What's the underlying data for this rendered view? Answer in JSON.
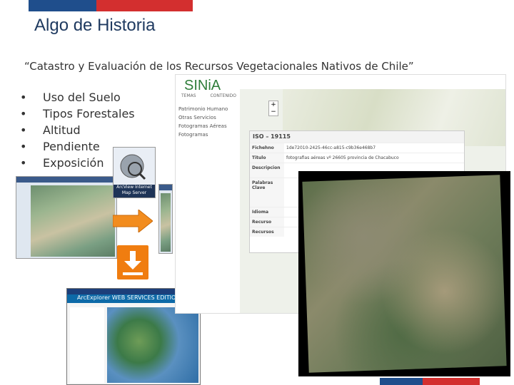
{
  "slide": {
    "title": "Algo de Historia",
    "subtitle": "“Catastro y Evaluación de los Recursos Vegetacionales Nativos de Chile”",
    "bullets": [
      "Uso del Suelo",
      "Tipos Forestales",
      "Altitud",
      "Pendiente",
      "Exposición"
    ]
  },
  "colors": {
    "flag_blue": "#1f4e8c",
    "flag_red": "#d32f2f",
    "title_color": "#1f3a60",
    "orange_arrow": "#f07d10"
  },
  "collage": {
    "ims_label": "ArcView Internet Map Server",
    "arcexplorer_label": "ArcExplorer WEB SERVICES EDITION",
    "download_icon": "download-arrow-icon"
  },
  "sinia": {
    "logo": "SINiA",
    "tabs": [
      "TEMAS",
      "CONTENIDO"
    ],
    "layers": [
      "Patrimonio Humano",
      "Otras Servicios",
      "Fotogramas Aéreas",
      "Fotogramas"
    ],
    "card": {
      "header": "ISO – 19115",
      "rows": [
        {
          "key": "Fichehno",
          "value": "1de72010-2425-46cc-a815-c9b36e468b7"
        },
        {
          "key": "Titulo",
          "value": "fotografias aéreas vº 26605 provincia de Chacabuco"
        },
        {
          "key": "Descripcion",
          "value": ""
        },
        {
          "key": "Palabras Clave",
          "value": ""
        },
        {
          "key": "Idioma",
          "value": ""
        },
        {
          "key": "Recurso",
          "value": ""
        },
        {
          "key": "Recursos",
          "value": ""
        }
      ]
    }
  }
}
